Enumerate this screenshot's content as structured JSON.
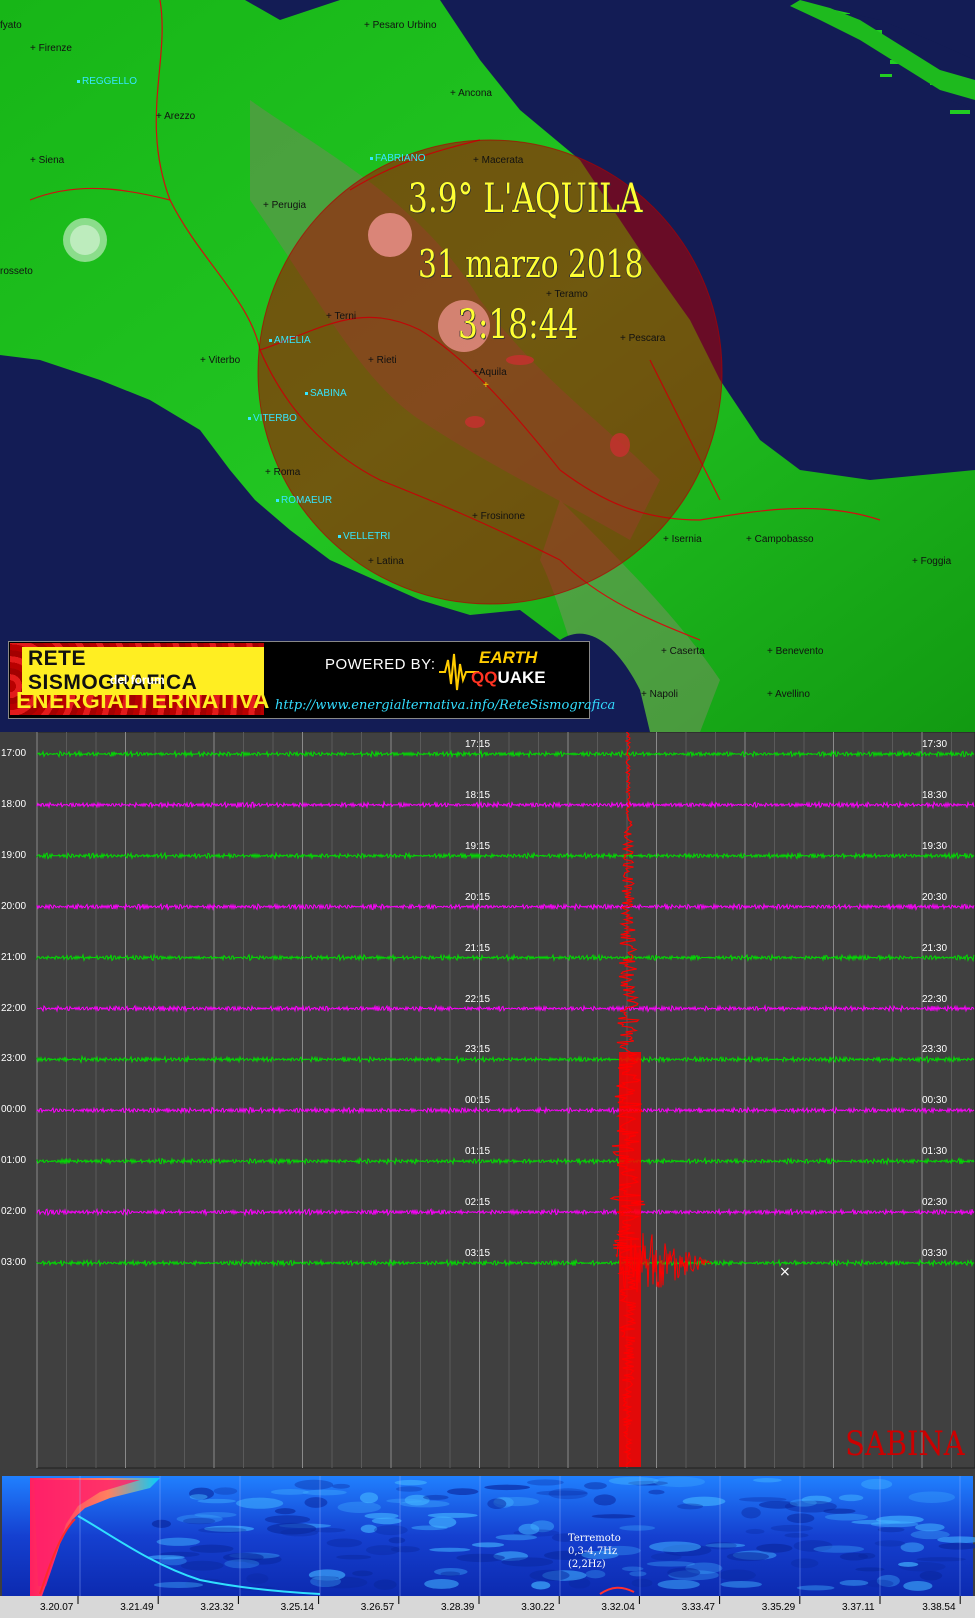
{
  "map": {
    "places": [
      {
        "name": "Pesaro Urbino",
        "type": "city"
      },
      {
        "name": "Firenze",
        "type": "city"
      },
      {
        "name": "REGGELLO",
        "type": "station"
      },
      {
        "name": "Arezzo",
        "type": "city"
      },
      {
        "name": "Ancona",
        "type": "city"
      },
      {
        "name": "Siena",
        "type": "city"
      },
      {
        "name": "FABRIANO",
        "type": "station"
      },
      {
        "name": "Macerata",
        "type": "city"
      },
      {
        "name": "Perugia",
        "type": "city"
      },
      {
        "name": "rosseto",
        "type": "city"
      },
      {
        "name": "Teramo",
        "type": "city"
      },
      {
        "name": "Terni",
        "type": "city"
      },
      {
        "name": "Pescara",
        "type": "city"
      },
      {
        "name": "AMELIA",
        "type": "station"
      },
      {
        "name": "Viterbo",
        "type": "city"
      },
      {
        "name": "Rieti",
        "type": "city"
      },
      {
        "name": "Aquila",
        "type": "city"
      },
      {
        "name": "SABINA",
        "type": "station"
      },
      {
        "name": "VITERBO",
        "type": "station"
      },
      {
        "name": "Roma",
        "type": "city"
      },
      {
        "name": "ROMAEUR",
        "type": "station"
      },
      {
        "name": "Frosinone",
        "type": "city"
      },
      {
        "name": "VELLETRI",
        "type": "station"
      },
      {
        "name": "Isernia",
        "type": "city"
      },
      {
        "name": "Campobasso",
        "type": "city"
      },
      {
        "name": "Latina",
        "type": "city"
      },
      {
        "name": "Foggia",
        "type": "city"
      },
      {
        "name": "Caserta",
        "type": "city"
      },
      {
        "name": "Benevento",
        "type": "city"
      },
      {
        "name": "Napoli",
        "type": "city"
      },
      {
        "name": "Avellino",
        "type": "city"
      },
      {
        "name": "fyato",
        "type": "city"
      }
    ],
    "quake": {
      "magnitude_text": "3.9° L'AQUILA",
      "date_text": "31 marzo 2018",
      "time_text": "3:18:44"
    }
  },
  "banner": {
    "title_line1": "RETE SISMOGRAFICA",
    "title_line2": "del forum",
    "title_line3": "ENERGIALTERNATIVA",
    "powered_by": "POWERED BY:",
    "logo_line1": "EARTH",
    "logo_line2_a": "QQ",
    "logo_line2_b": "UAKE",
    "url": "http://www.energialternativa.info/ReteSismografica"
  },
  "seismogram": {
    "station": "SABINA",
    "rows": [
      {
        "left": "17:00",
        "mid": "17:15",
        "right": "17:30",
        "color": "#00e000"
      },
      {
        "left": "18:00",
        "mid": "18:15",
        "right": "18:30",
        "color": "#ff00ff"
      },
      {
        "left": "19:00",
        "mid": "19:15",
        "right": "19:30",
        "color": "#00e000"
      },
      {
        "left": "20:00",
        "mid": "20:15",
        "right": "20:30",
        "color": "#ff00ff"
      },
      {
        "left": "21:00",
        "mid": "21:15",
        "right": "21:30",
        "color": "#00e000"
      },
      {
        "left": "22:00",
        "mid": "22:15",
        "right": "22:30",
        "color": "#ff00ff"
      },
      {
        "left": "23:00",
        "mid": "23:15",
        "right": "23:30",
        "color": "#00e000"
      },
      {
        "left": "00:00",
        "mid": "00:15",
        "right": "00:30",
        "color": "#ff00ff"
      },
      {
        "left": "01:00",
        "mid": "01:15",
        "right": "01:30",
        "color": "#00e000"
      },
      {
        "left": "02:00",
        "mid": "02:15",
        "right": "02:30",
        "color": "#ff00ff"
      },
      {
        "left": "03:00",
        "mid": "03:15",
        "right": "03:30",
        "color": "#00e000"
      }
    ],
    "event_color": "#ff0000"
  },
  "spectrogram": {
    "note_line1": "Terremoto",
    "note_line2": "0,3-4,7Hz",
    "note_line3": "(2,2Hz)",
    "ticks": [
      "3.20.07",
      "3.21.49",
      "3.23.32",
      "3.25.14",
      "3.26.57",
      "3.28.39",
      "3.30.22",
      "3.32.04",
      "3.33.47",
      "3.35.29",
      "3.37.11",
      "3.38.54"
    ]
  }
}
